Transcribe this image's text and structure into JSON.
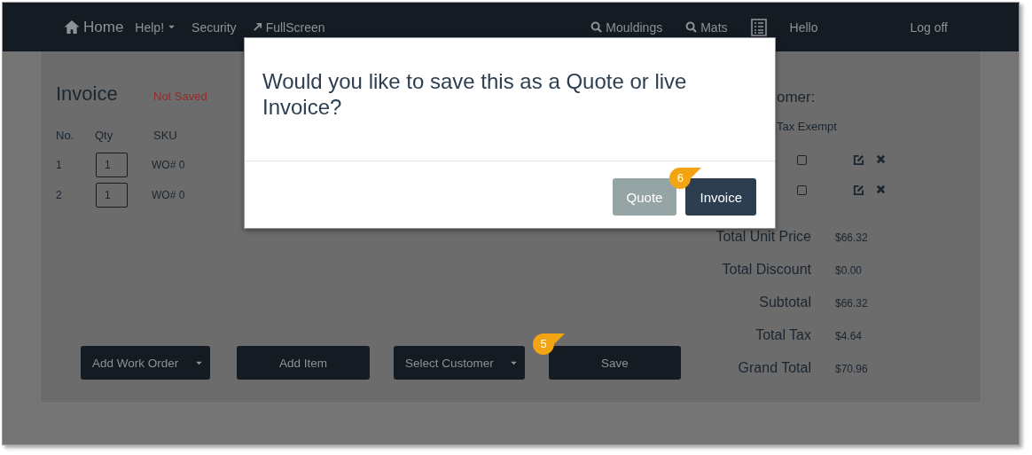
{
  "nav": {
    "brand": "Home",
    "left_items": [
      {
        "label": "Help!",
        "kind": "dropdown"
      },
      {
        "label": "Security",
        "kind": "link"
      },
      {
        "label": "FullScreen",
        "kind": "fullscreen"
      }
    ],
    "right_items": [
      {
        "label": "Mouldings",
        "kind": "search"
      },
      {
        "label": "Mats",
        "kind": "search"
      },
      {
        "kind": "list"
      }
    ],
    "greeting": "Hello",
    "logoff": "Log off"
  },
  "invoice": {
    "title": "Invoice",
    "status": "Not Saved",
    "columns": [
      "No.",
      "Qty",
      "SKU"
    ],
    "rows": [
      {
        "no": "1",
        "qty": "1",
        "sku": "WO# 0",
        "tax_exempt": false
      },
      {
        "no": "2",
        "qty": "1",
        "sku": "WO# 0",
        "tax_exempt": false
      }
    ],
    "customer_label": "omer:",
    "tax_exempt_label": "Tax Exempt",
    "totals": [
      {
        "label": "Total Unit Price",
        "value": "$66.32"
      },
      {
        "label": "Total Discount",
        "value": "$0.00"
      },
      {
        "label": "Subtotal",
        "value": "$66.32"
      },
      {
        "label": "Total Tax",
        "value": "$4.64"
      },
      {
        "label": "Grand Total",
        "value": "$70.96"
      }
    ],
    "buttons": [
      {
        "label": "Add Work Order",
        "kind": "dropdown"
      },
      {
        "label": "Add Item",
        "kind": "plain"
      },
      {
        "label": "Select Customer",
        "kind": "dropdown"
      },
      {
        "label": "Save",
        "kind": "plain",
        "callout": "5"
      }
    ]
  },
  "dialog": {
    "message": "Would you like to save this as a Quote or live Invoice?",
    "buttons": [
      {
        "label": "Quote",
        "kind": "secondary"
      },
      {
        "label": "Invoice",
        "kind": "primary",
        "callout": "6"
      }
    ]
  }
}
